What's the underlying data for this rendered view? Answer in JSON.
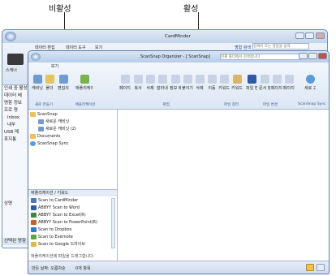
{
  "annotations": {
    "inactive": "비활성",
    "active": "활성"
  },
  "back_window": {
    "title": "CardMinder",
    "tabs": [
      "데이터 편집",
      "데이터 도구",
      "보기"
    ],
    "search_label": "명함 검색",
    "search_placeholder": "검색어 또는 명함을 입력",
    "scan_label": "스캐너",
    "left_items": [
      "인쇄 중 활성",
      "데이터 베",
      "명함 정보",
      "프로 명",
      "Inbox",
      "내부",
      "USB 메",
      "휴지통"
    ],
    "bottom_items": [
      "상명",
      "선택된 명함"
    ]
  },
  "front_window": {
    "title": "ScanSnap Organizer - [ ScanSnap]",
    "search_placeholder": "현재 폴더에서 검색합니다",
    "tab": "보기",
    "ribbon_buttons": [
      "캐비닛",
      "폴더",
      "편집의 일기",
      "애플리케이션",
      "페이지",
      "복사",
      "삭제",
      "잘라내기",
      "정보 메뉴",
      "붙이기",
      "삭제",
      "이동",
      "키워드 편집",
      "키워드 추가",
      "파일 변환",
      "문서 병합",
      "페이지 회전",
      "페이지 정리",
      "새로 고침"
    ],
    "groups": [
      "새로 만들기",
      "애플리케이션",
      "편집",
      "파일 정리",
      "파일 변경",
      "ScanSnap Sync"
    ],
    "tree": {
      "root": "ScanSnap",
      "items": [
        "새로운 캐비닛",
        "새로운 캐비닛 (2)",
        "Documents",
        "ScanSnap Sync"
      ]
    },
    "apps_header": "애플리케이션 / 키워드",
    "apps": [
      "Scan to CardMinder",
      "ABBYY Scan to Word",
      "ABBYY Scan to Excel(R)",
      "ABBYY Scan to PowerPoint(R)",
      "Scan to Dropbox",
      "Scan to Evernote",
      "Scan to Google 드라이브"
    ],
    "apps_footer": "애플리케이션에 파일을 드래그합니다.",
    "status": [
      "만든 날짜: 오름차순",
      "0개 항목"
    ]
  },
  "colors": {
    "accent": "#4a78b8",
    "frame": "#5b7aa8"
  }
}
